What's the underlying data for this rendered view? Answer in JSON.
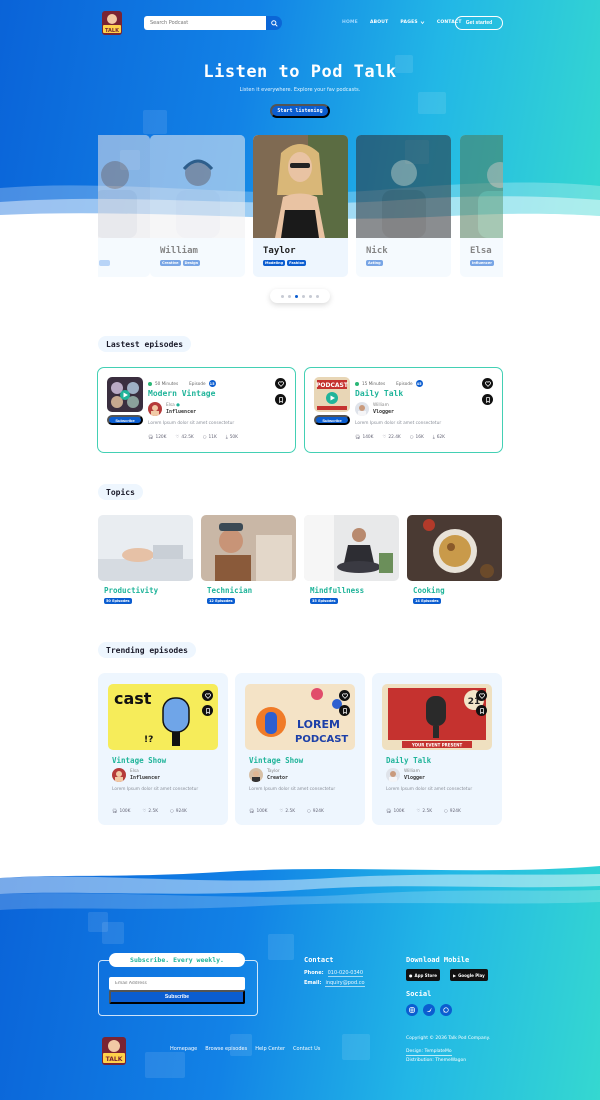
{
  "header": {
    "search_placeholder": "Search Podcast",
    "nav": [
      "HOME",
      "ABOUT",
      "PAGES",
      "CONTACT"
    ],
    "get_started": "Get started"
  },
  "hero": {
    "title": "Listen to Pod Talk",
    "subtitle": "Listen it everywhere. Explore your fav podcasts.",
    "cta": "Start listening"
  },
  "hosts": [
    {
      "name": "William",
      "tags": [
        "Creative",
        "Design"
      ]
    },
    {
      "name": "Taylor",
      "tags": [
        "Modeling",
        "Fashion"
      ]
    },
    {
      "name": "Nick",
      "tags": [
        "Acting"
      ]
    },
    {
      "name": "Elsa",
      "tags": [
        "Influencer"
      ]
    }
  ],
  "latest": {
    "label": "Lastest episodes",
    "items": [
      {
        "duration": "50 Minutes",
        "episode_label": "Episode",
        "episode_no": "15",
        "title": "Modern Vintage",
        "author": "Elsa",
        "role": "Influencer",
        "desc": "Lorem Ipsum dolor sit amet consectetur",
        "stats": [
          "120K",
          "42.5K",
          "11K",
          "50K"
        ],
        "subscribe": "Subscribe"
      },
      {
        "duration": "15 Minutes",
        "episode_label": "Episode",
        "episode_no": "45",
        "title": "Daily Talk",
        "author": "William",
        "role": "Vlogger",
        "desc": "Lorem Ipsum dolor sit amet consectetur",
        "stats": [
          "140K",
          "22.4K",
          "16K",
          "62K"
        ],
        "subscribe": "Subscribe"
      }
    ]
  },
  "topics": {
    "label": "Topics",
    "items": [
      {
        "name": "Productivity",
        "count": "50 Episodes"
      },
      {
        "name": "Technician",
        "count": "12 Episodes"
      },
      {
        "name": "Mindfullness",
        "count": "35 Episodes"
      },
      {
        "name": "Cooking",
        "count": "14 Episodes"
      }
    ]
  },
  "trending": {
    "label": "Trending episodes",
    "items": [
      {
        "title": "Vintage Show",
        "author": "Elsa",
        "role": "Influencer",
        "desc": "Lorem Ipsum dolor sit amet consectetur",
        "stats": [
          "100K",
          "2.5K",
          "924K"
        ],
        "art_text": "LOREM PODCAST",
        "art2": "cast"
      },
      {
        "title": "Vintage Show",
        "author": "Taylor",
        "role": "Creator",
        "desc": "Lorem Ipsum dolor sit amet consectetur",
        "stats": [
          "100K",
          "2.5K",
          "924K"
        ],
        "art_text": "LOREM PODCAST"
      },
      {
        "title": "Daily Talk",
        "author": "William",
        "role": "Vlogger",
        "desc": "Lorem Ipsum dolor sit amet consectetur",
        "stats": [
          "100K",
          "2.5K",
          "924K"
        ],
        "art_text": "YOUR EVENT PRESENT"
      }
    ]
  },
  "footer": {
    "subscribe_head": "Subscribe. Every weekly.",
    "email_placeholder": "Email Address",
    "subscribe_btn": "Subscribe",
    "contact_head": "Contact",
    "phone_label": "Phone:",
    "phone": "010-020-0340",
    "email_label": "Email:",
    "email": "inquiry@pod.co",
    "download_head": "Download Mobile",
    "app_store": "App Store",
    "google_play": "Google Play",
    "social_head": "Social",
    "links": [
      "Homepage",
      "Browse episodes",
      "Help Center",
      "Contact Us"
    ],
    "copyright": "Copyright © 2036 Talk Pod Company.",
    "design": "Design: TemplateMo",
    "distribution": "Distribution: ThemeWagon"
  },
  "colors": {
    "primary": "#0b5dd0",
    "accent": "#20b49a",
    "border": "#43d0b4"
  }
}
